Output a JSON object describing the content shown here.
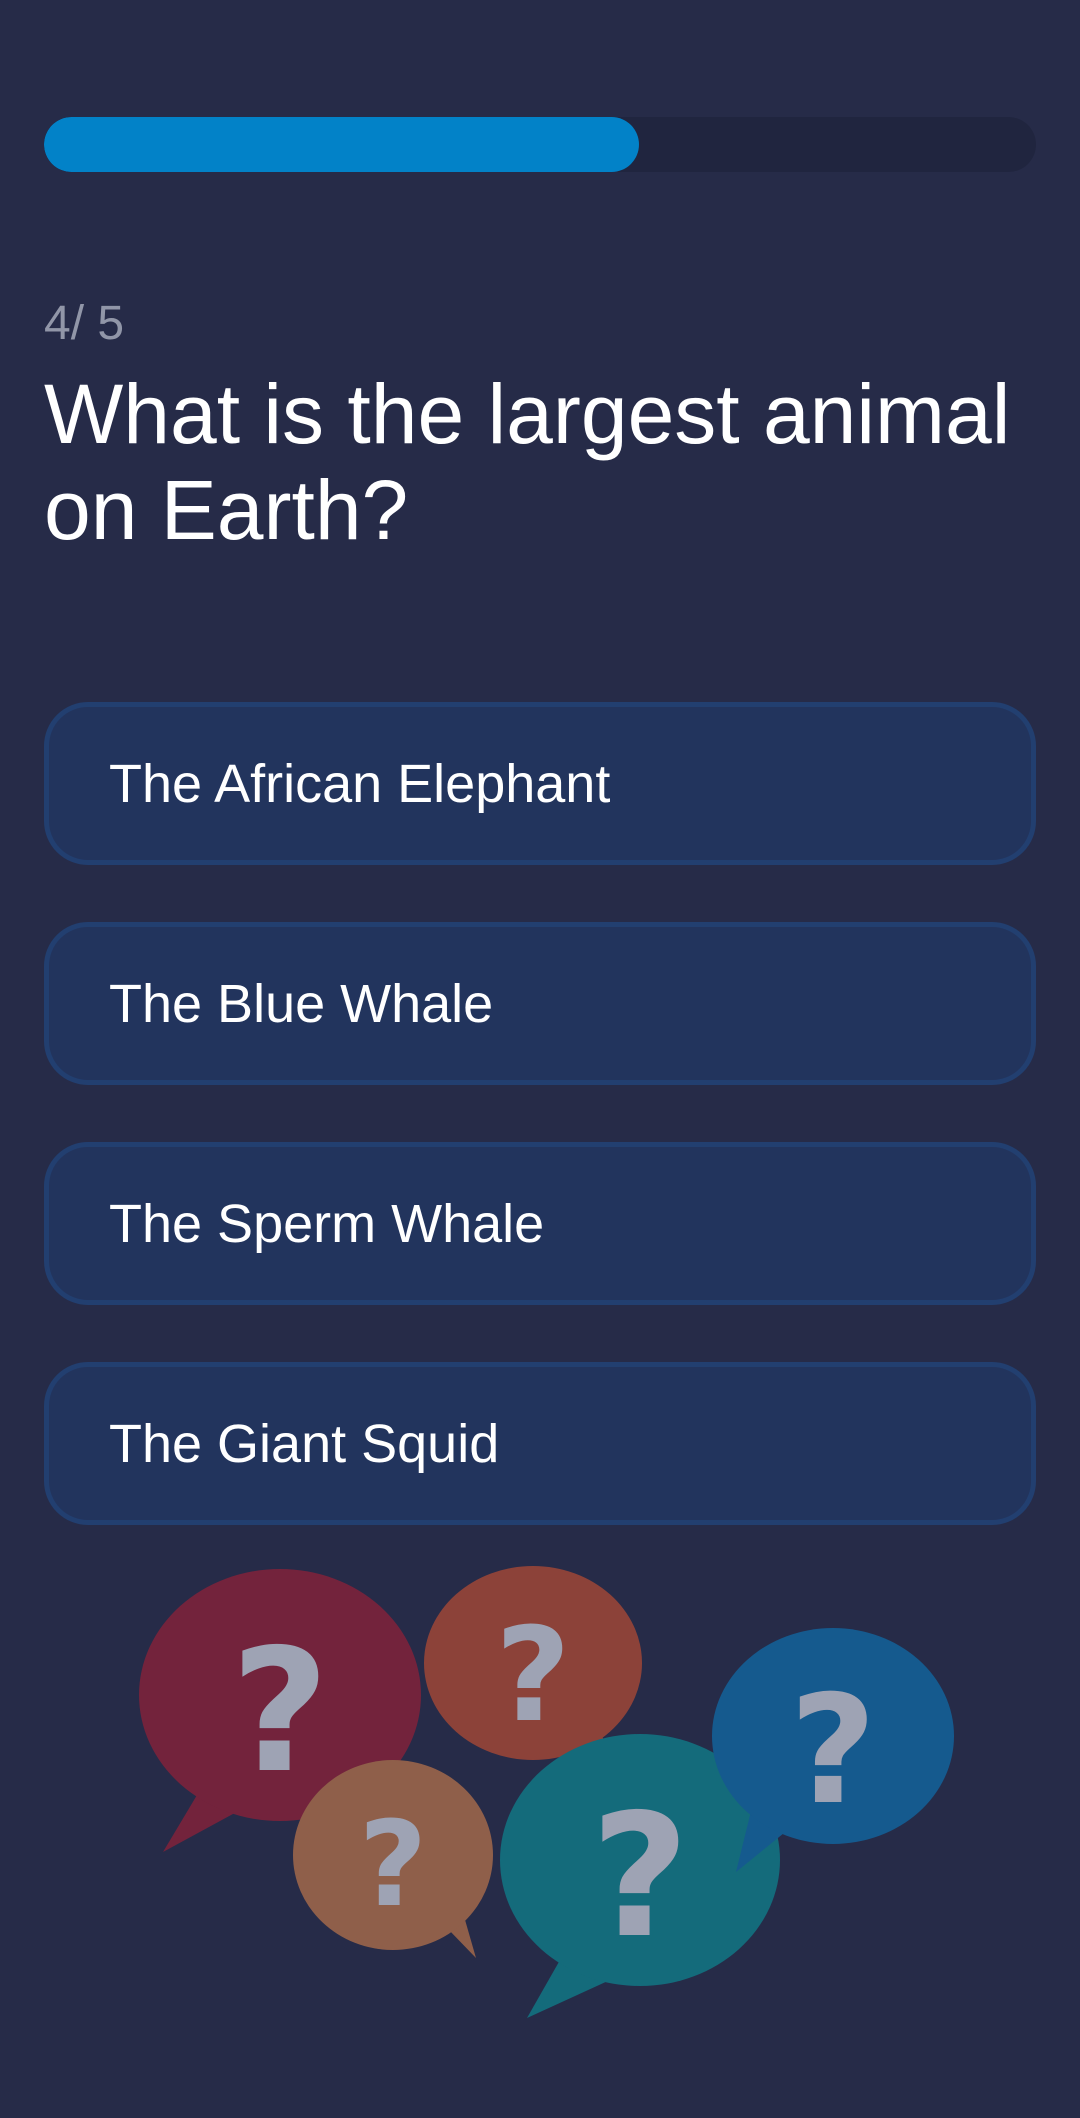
{
  "progress": {
    "fraction": 0.6,
    "fill_color": "#0282c8",
    "track_color": "#20253f"
  },
  "question": {
    "counter_current": "4",
    "counter_separator": "/",
    "counter_total": "5",
    "text": "What is the largest animal on Earth?"
  },
  "options": [
    {
      "label": "The African Elephant"
    },
    {
      "label": "The Blue Whale"
    },
    {
      "label": "The Sperm Whale"
    },
    {
      "label": "The Giant Squid"
    }
  ],
  "illustration": {
    "icon": "question-bubbles-icon",
    "glyph": "?",
    "colors": [
      "#73233c",
      "#8c4239",
      "#8f5f4a",
      "#146b7b",
      "#155a8e"
    ]
  }
}
